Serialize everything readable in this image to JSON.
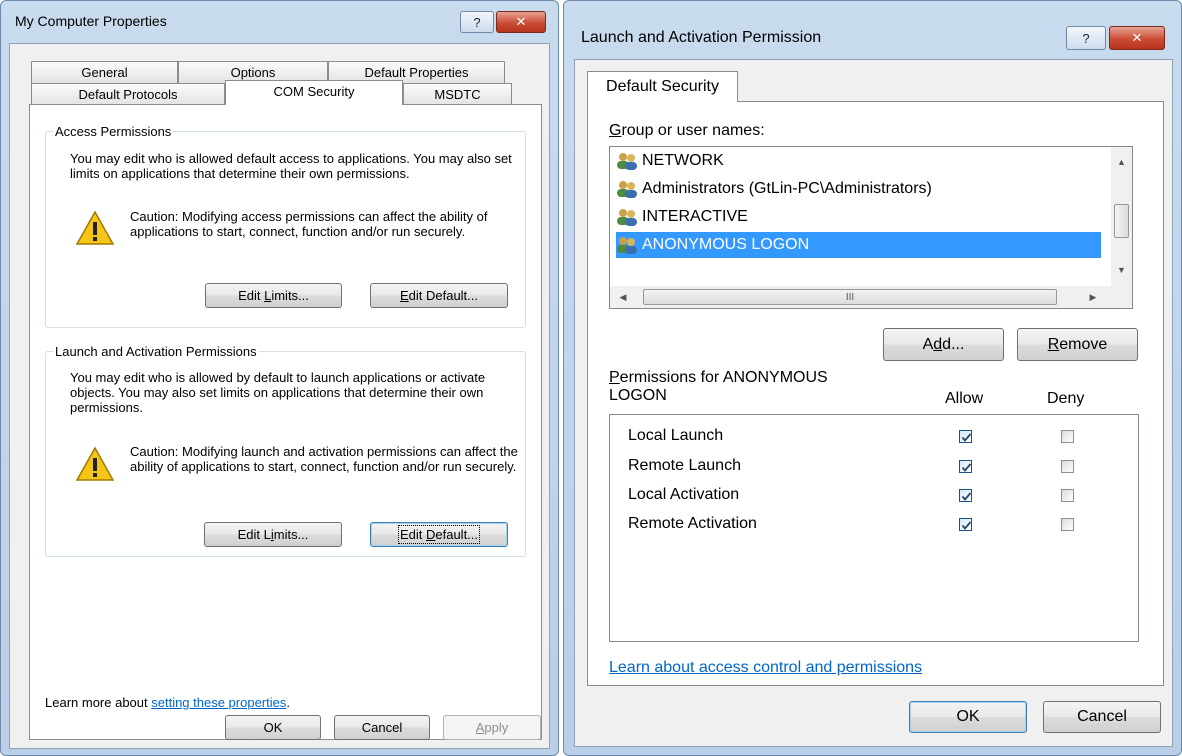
{
  "left_window": {
    "title": "My Computer Properties",
    "tabs_row1": [
      "General",
      "Options",
      "Default Properties"
    ],
    "tabs_row2": [
      "Default Protocols",
      "COM Security",
      "MSDTC"
    ],
    "access": {
      "group_label": "Access Permissions",
      "description": "You may edit who is allowed default access to applications. You may also set limits on applications that determine their own permissions.",
      "caution": "Caution: Modifying access permissions can affect the ability of applications to start, connect, function and/or run securely.",
      "edit_limits": {
        "pre": "Edit ",
        "key": "L",
        "post": "imits..."
      },
      "edit_default": {
        "pre": "",
        "key": "E",
        "post": "dit Default..."
      }
    },
    "launch": {
      "group_label": "Launch and Activation Permissions",
      "description": "You may edit who is allowed by default to launch applications or activate objects. You may also set limits on applications that determine their own permissions.",
      "caution": "Caution: Modifying launch and activation permissions can affect the ability of applications to start, connect, function and/or run securely.",
      "edit_limits": {
        "pre": "Edit L",
        "key": "i",
        "post": "mits..."
      },
      "edit_default": {
        "pre": "Edit ",
        "key": "D",
        "post": "efault..."
      }
    },
    "learn_more_prefix": "Learn more about ",
    "learn_more_link": "setting these properties",
    "learn_more_suffix": ".",
    "ok": "OK",
    "cancel": "Cancel",
    "apply": {
      "pre": "",
      "key": "A",
      "post": "pply"
    }
  },
  "right_window": {
    "title": "Launch and Activation Permission",
    "tab": "Default Security",
    "group_names_label": {
      "pre": "",
      "key": "G",
      "post": "roup or user names:"
    },
    "users": [
      "NETWORK",
      "Administrators (GtLin-PC\\Administrators)",
      "INTERACTIVE",
      "ANONYMOUS LOGON"
    ],
    "selected_user_index": 3,
    "hscroll_grip": "III",
    "add": {
      "pre": "A",
      "key": "d",
      "post": "d..."
    },
    "remove": {
      "pre": "",
      "key": "R",
      "post": "emove"
    },
    "permissions_for": {
      "pre": "",
      "key": "P",
      "post": "ermissions for ANONYMOUS LOGON"
    },
    "allow_header": "Allow",
    "deny_header": "Deny",
    "permissions": [
      {
        "name": "Local Launch",
        "allow": true,
        "deny": false
      },
      {
        "name": "Remote Launch",
        "allow": true,
        "deny": false
      },
      {
        "name": "Local Activation",
        "allow": true,
        "deny": false
      },
      {
        "name": "Remote Activation",
        "allow": true,
        "deny": false
      }
    ],
    "learn_link": "Learn about access control and permissions",
    "ok": "OK",
    "cancel": "Cancel"
  },
  "title_buttons": {
    "help": "?",
    "close": "✕"
  },
  "colors": {
    "selection": "#3399ff",
    "link": "#0066cc",
    "close_red": "#c94d36"
  }
}
